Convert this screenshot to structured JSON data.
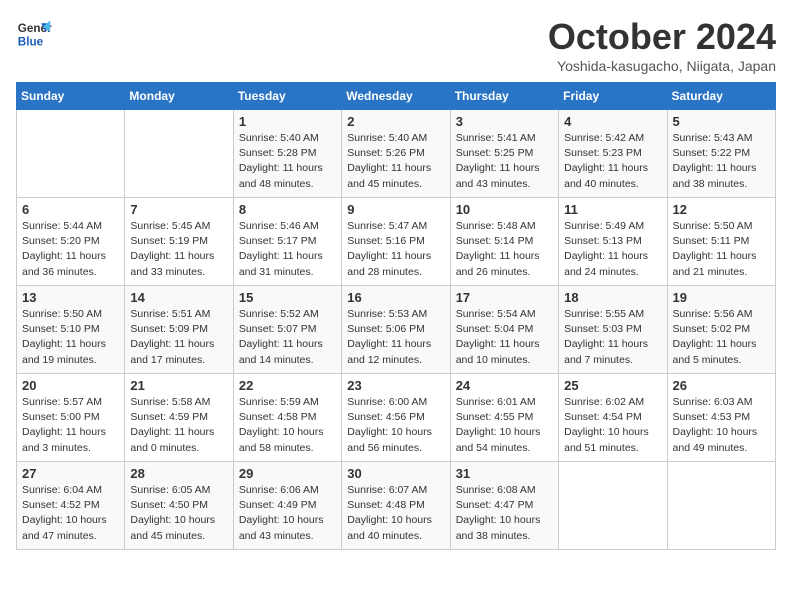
{
  "header": {
    "logo_line1": "General",
    "logo_line2": "Blue",
    "title": "October 2024",
    "location": "Yoshida-kasugacho, Niigata, Japan"
  },
  "weekdays": [
    "Sunday",
    "Monday",
    "Tuesday",
    "Wednesday",
    "Thursday",
    "Friday",
    "Saturday"
  ],
  "weeks": [
    [
      {
        "day": "",
        "info": ""
      },
      {
        "day": "",
        "info": ""
      },
      {
        "day": "1",
        "info": "Sunrise: 5:40 AM\nSunset: 5:28 PM\nDaylight: 11 hours and 48 minutes."
      },
      {
        "day": "2",
        "info": "Sunrise: 5:40 AM\nSunset: 5:26 PM\nDaylight: 11 hours and 45 minutes."
      },
      {
        "day": "3",
        "info": "Sunrise: 5:41 AM\nSunset: 5:25 PM\nDaylight: 11 hours and 43 minutes."
      },
      {
        "day": "4",
        "info": "Sunrise: 5:42 AM\nSunset: 5:23 PM\nDaylight: 11 hours and 40 minutes."
      },
      {
        "day": "5",
        "info": "Sunrise: 5:43 AM\nSunset: 5:22 PM\nDaylight: 11 hours and 38 minutes."
      }
    ],
    [
      {
        "day": "6",
        "info": "Sunrise: 5:44 AM\nSunset: 5:20 PM\nDaylight: 11 hours and 36 minutes."
      },
      {
        "day": "7",
        "info": "Sunrise: 5:45 AM\nSunset: 5:19 PM\nDaylight: 11 hours and 33 minutes."
      },
      {
        "day": "8",
        "info": "Sunrise: 5:46 AM\nSunset: 5:17 PM\nDaylight: 11 hours and 31 minutes."
      },
      {
        "day": "9",
        "info": "Sunrise: 5:47 AM\nSunset: 5:16 PM\nDaylight: 11 hours and 28 minutes."
      },
      {
        "day": "10",
        "info": "Sunrise: 5:48 AM\nSunset: 5:14 PM\nDaylight: 11 hours and 26 minutes."
      },
      {
        "day": "11",
        "info": "Sunrise: 5:49 AM\nSunset: 5:13 PM\nDaylight: 11 hours and 24 minutes."
      },
      {
        "day": "12",
        "info": "Sunrise: 5:50 AM\nSunset: 5:11 PM\nDaylight: 11 hours and 21 minutes."
      }
    ],
    [
      {
        "day": "13",
        "info": "Sunrise: 5:50 AM\nSunset: 5:10 PM\nDaylight: 11 hours and 19 minutes."
      },
      {
        "day": "14",
        "info": "Sunrise: 5:51 AM\nSunset: 5:09 PM\nDaylight: 11 hours and 17 minutes."
      },
      {
        "day": "15",
        "info": "Sunrise: 5:52 AM\nSunset: 5:07 PM\nDaylight: 11 hours and 14 minutes."
      },
      {
        "day": "16",
        "info": "Sunrise: 5:53 AM\nSunset: 5:06 PM\nDaylight: 11 hours and 12 minutes."
      },
      {
        "day": "17",
        "info": "Sunrise: 5:54 AM\nSunset: 5:04 PM\nDaylight: 11 hours and 10 minutes."
      },
      {
        "day": "18",
        "info": "Sunrise: 5:55 AM\nSunset: 5:03 PM\nDaylight: 11 hours and 7 minutes."
      },
      {
        "day": "19",
        "info": "Sunrise: 5:56 AM\nSunset: 5:02 PM\nDaylight: 11 hours and 5 minutes."
      }
    ],
    [
      {
        "day": "20",
        "info": "Sunrise: 5:57 AM\nSunset: 5:00 PM\nDaylight: 11 hours and 3 minutes."
      },
      {
        "day": "21",
        "info": "Sunrise: 5:58 AM\nSunset: 4:59 PM\nDaylight: 11 hours and 0 minutes."
      },
      {
        "day": "22",
        "info": "Sunrise: 5:59 AM\nSunset: 4:58 PM\nDaylight: 10 hours and 58 minutes."
      },
      {
        "day": "23",
        "info": "Sunrise: 6:00 AM\nSunset: 4:56 PM\nDaylight: 10 hours and 56 minutes."
      },
      {
        "day": "24",
        "info": "Sunrise: 6:01 AM\nSunset: 4:55 PM\nDaylight: 10 hours and 54 minutes."
      },
      {
        "day": "25",
        "info": "Sunrise: 6:02 AM\nSunset: 4:54 PM\nDaylight: 10 hours and 51 minutes."
      },
      {
        "day": "26",
        "info": "Sunrise: 6:03 AM\nSunset: 4:53 PM\nDaylight: 10 hours and 49 minutes."
      }
    ],
    [
      {
        "day": "27",
        "info": "Sunrise: 6:04 AM\nSunset: 4:52 PM\nDaylight: 10 hours and 47 minutes."
      },
      {
        "day": "28",
        "info": "Sunrise: 6:05 AM\nSunset: 4:50 PM\nDaylight: 10 hours and 45 minutes."
      },
      {
        "day": "29",
        "info": "Sunrise: 6:06 AM\nSunset: 4:49 PM\nDaylight: 10 hours and 43 minutes."
      },
      {
        "day": "30",
        "info": "Sunrise: 6:07 AM\nSunset: 4:48 PM\nDaylight: 10 hours and 40 minutes."
      },
      {
        "day": "31",
        "info": "Sunrise: 6:08 AM\nSunset: 4:47 PM\nDaylight: 10 hours and 38 minutes."
      },
      {
        "day": "",
        "info": ""
      },
      {
        "day": "",
        "info": ""
      }
    ]
  ]
}
